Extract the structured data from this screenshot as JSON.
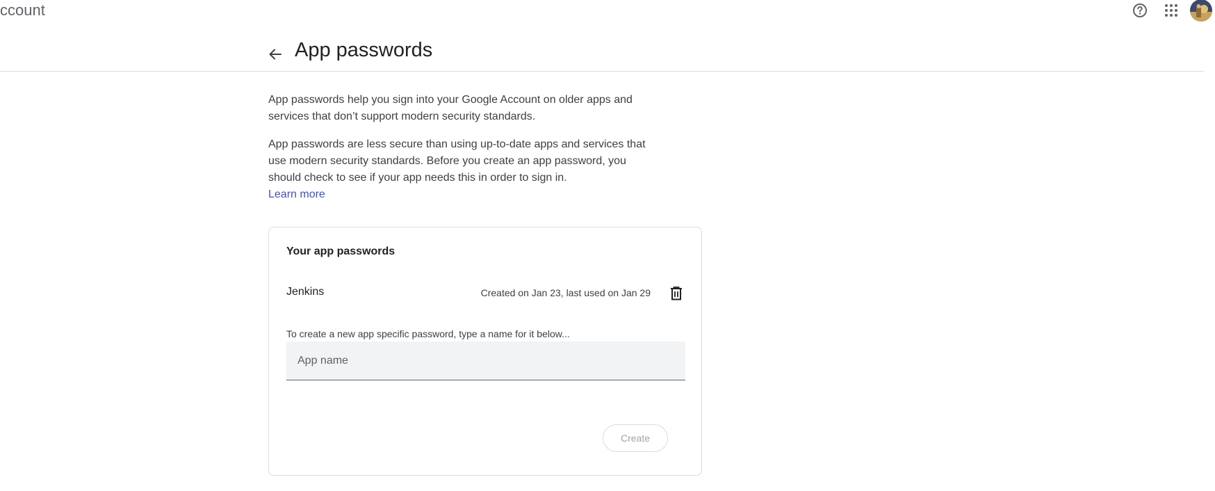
{
  "topbar": {
    "brand_text": "ccount",
    "icons": {
      "help": "help-circle-icon",
      "apps": "apps-grid-icon",
      "avatar": "account-avatar"
    }
  },
  "header": {
    "back_icon": "arrow-left-icon",
    "title": "App passwords"
  },
  "intro": {
    "paragraph1": "App passwords help you sign into your Google Account on older apps and services that don’t support modern security standards.",
    "paragraph2": "App passwords are less secure than using up-to-date apps and services that use modern security standards. Before you create an app password, you should check to see if your app needs this in order to sign in.",
    "learn_more": "Learn more"
  },
  "card": {
    "title": "Your app passwords",
    "passwords": [
      {
        "name": "Jenkins",
        "meta": "Created on Jan 23, last used on Jan 29",
        "delete_icon": "trash-icon"
      }
    ],
    "hint": "To create a new app specific password, type a name for it below...",
    "input_placeholder": "App name",
    "input_value": "",
    "create_label": "Create"
  },
  "colors": {
    "link": "#4150c4",
    "text": "#202124",
    "muted": "#5f6368",
    "border": "#dadce0",
    "input_bg": "#f1f3f4",
    "disabled": "#a0a3a7"
  }
}
